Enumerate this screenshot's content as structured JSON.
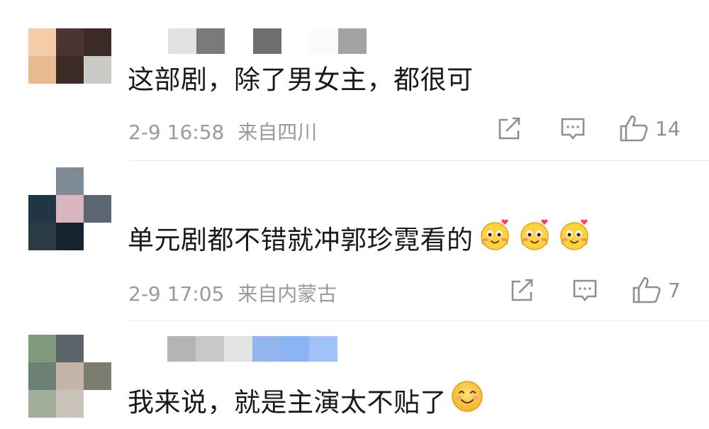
{
  "comments": [
    {
      "text": "这部剧，除了男女主，都很可",
      "date": "2-9 16:58",
      "location": "来自四川",
      "likes": "14",
      "avatar_colors": [
        "#f4cda8",
        "#4a3530",
        "#3b2a26",
        "#e9b98f",
        "#3c2a24",
        "#c9cac5",
        "#ffffff",
        "#ffffff",
        "#ffffff"
      ],
      "name_colors": [
        "#ffffff",
        "#e2e2e2",
        "#7a7a7a",
        "#ffffff",
        "#6f6f6f",
        "#ffffff",
        "#fafafa",
        "#a3a3a3"
      ],
      "emoji_count": 0
    },
    {
      "text": "单元剧都不错就冲郭珍霓看的",
      "date": "2-9 17:05",
      "location": "来自内蒙古",
      "likes": "7",
      "avatar_colors": [
        "#ffffff",
        "#7e8b95",
        "#ffffff",
        "#203644",
        "#d9b6bf",
        "#5b6671",
        "#2a3b44",
        "#17232c",
        "#ffffff"
      ],
      "name_colors": [],
      "emoji_count": 3
    },
    {
      "text": "我来说，就是主演太不贴了",
      "avatar_colors": [
        "#7f9b7c",
        "#5b636b",
        "#ffffff",
        "#6b7f74",
        "#c3b5a7",
        "#7d7c70",
        "#a0ad98",
        "#c8c2b9",
        "#ffffff"
      ],
      "name_colors": [
        "#b4b4b4",
        "#c8c8c8",
        "#e3e3e3",
        "#93b6ee",
        "#8ab4f4",
        "#9fc3f8"
      ],
      "emoji_count": 1
    }
  ],
  "icons": {
    "share": "share-icon",
    "comment": "comment-icon",
    "like": "thumbs-up-icon",
    "emoji_heart": "heart-eyes-emoji-icon",
    "emoji_smile": "smile-emoji-icon"
  }
}
